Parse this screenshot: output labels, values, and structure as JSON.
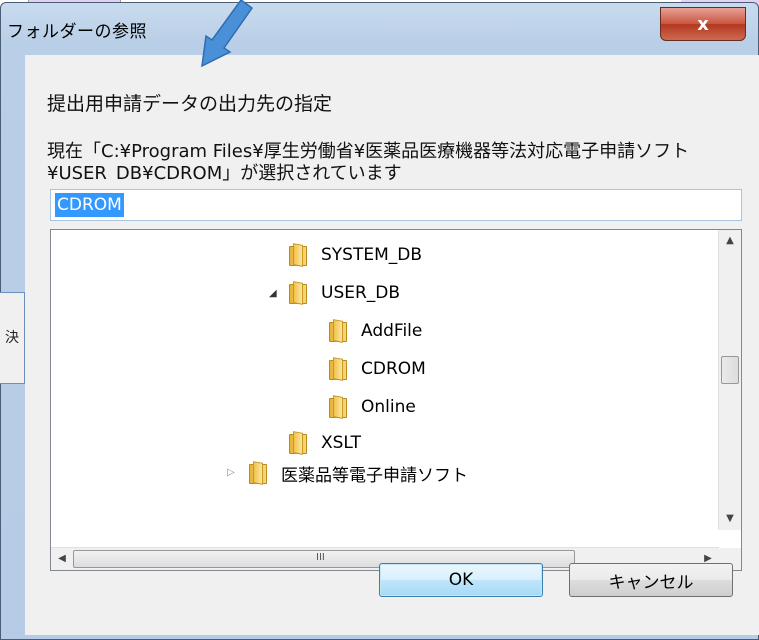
{
  "background": {
    "side_label": "決"
  },
  "dialog": {
    "title": "フォルダーの参照",
    "close_glyph": "x",
    "instruction": "提出用申請データの出力先の指定",
    "current_path": "現在「C:¥Program Files¥厚生労働省¥医薬品医療機器等法対応電子申請ソフト¥USER_DB¥CDROM」が選択されています",
    "folder_name_value": "CDROM"
  },
  "tree": {
    "items": [
      {
        "label": "SYSTEM_DB",
        "expander": ""
      },
      {
        "label": "USER_DB",
        "expander": "◢"
      },
      {
        "label": "AddFile",
        "expander": ""
      },
      {
        "label": "CDROM",
        "expander": ""
      },
      {
        "label": "Online",
        "expander": ""
      },
      {
        "label": "XSLT",
        "expander": ""
      },
      {
        "label": "医薬品等電子申請ソフト",
        "expander": "▷"
      }
    ],
    "scroll_up": "▲",
    "scroll_down": "▼",
    "scroll_left": "◀",
    "scroll_right": "▶",
    "h_grip": "III"
  },
  "buttons": {
    "ok": "OK",
    "cancel": "キャンセル"
  },
  "colors": {
    "selection": "#3399ff",
    "annotation_arrow": "#4a90d9"
  }
}
